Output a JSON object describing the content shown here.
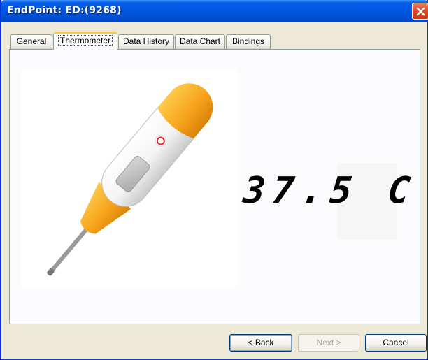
{
  "window": {
    "title": "EndPoint:  ED:(9268)"
  },
  "tabs": [
    {
      "label": "General"
    },
    {
      "label": "Thermometer"
    },
    {
      "label": "Data History"
    },
    {
      "label": "Data Chart"
    },
    {
      "label": "Bindings"
    }
  ],
  "active_tab": "Thermometer",
  "thermometer": {
    "reading": "37.5 C"
  },
  "footer": {
    "back_label": "< Back",
    "next_label": "Next >",
    "cancel_label": "Cancel"
  },
  "colors": {
    "titlebar": "#0055e5",
    "thermometer_accent": "#f5a623",
    "close_button": "#d5472a"
  }
}
